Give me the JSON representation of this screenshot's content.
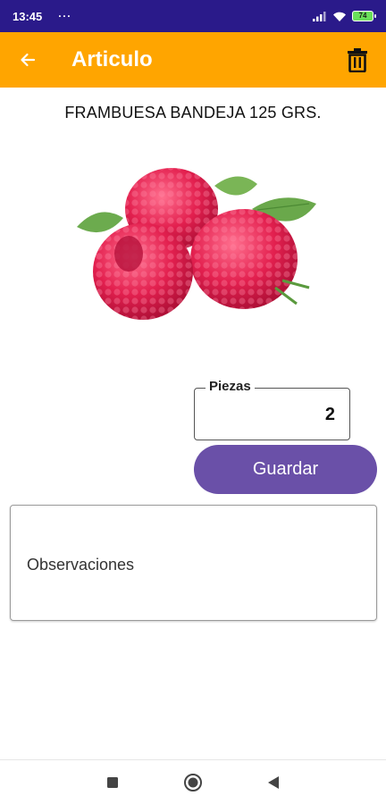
{
  "status_bar": {
    "time": "13:45",
    "dots": "···",
    "battery_level": "74",
    "icons": [
      "signal-icon",
      "wifi-icon",
      "battery-icon"
    ]
  },
  "app_bar": {
    "title": "Articulo",
    "background_color": "#ffa500",
    "back_icon": "arrow-left-icon",
    "delete_icon": "trash-icon"
  },
  "product": {
    "name": "FRAMBUESA BANDEJA 125 GRS.",
    "image": "raspberries-image"
  },
  "form": {
    "quantity_label": "Piezas",
    "quantity_value": "2",
    "save_label": "Guardar",
    "save_color": "#6a50a8",
    "notes_placeholder": "Observaciones"
  },
  "nav_bar": {
    "buttons": [
      "recents-square-icon",
      "home-circle-icon",
      "back-triangle-icon"
    ]
  }
}
